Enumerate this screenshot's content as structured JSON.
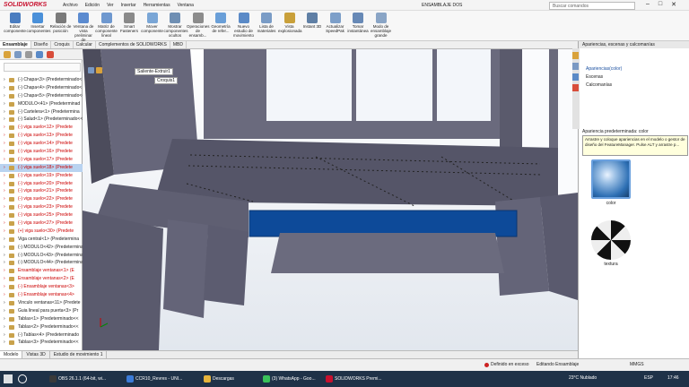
{
  "window": {
    "title": "ENSAMBLAJE DOS",
    "brand": "SOLIDWORKS",
    "search_placeholder": "Buscar comandos",
    "minimize": "–",
    "maximize": "□",
    "close": "✕"
  },
  "menu": [
    "Archivo",
    "Edición",
    "Ver",
    "Insertar",
    "Herramientas",
    "Ventana"
  ],
  "ribbon": [
    {
      "label": "Editar componente",
      "color": "#4a7dc0"
    },
    {
      "label": "Insertar componentes",
      "color": "#4a90d9"
    },
    {
      "label": "Relación de posición",
      "color": "#7a7a7a"
    },
    {
      "label": "Ventana de vista preliminar de componente",
      "color": "#5b8bd0"
    },
    {
      "label": "Matriz de componente lineal",
      "color": "#6e98cf"
    },
    {
      "label": "Smart Fasteners",
      "color": "#8a8a8a"
    },
    {
      "label": "Mover componente",
      "color": "#7aa6d6"
    },
    {
      "label": "Mostrar componentes ocultos",
      "color": "#6f8fb3"
    },
    {
      "label": "Operaciones de ensamb...",
      "color": "#8c8c8c"
    },
    {
      "label": "Geometría de refer...",
      "color": "#6a9fd8"
    },
    {
      "label": "Nuevo estudio de movimiento",
      "color": "#5a8ac7"
    },
    {
      "label": "Lista de materiales",
      "color": "#7a9cc6"
    },
    {
      "label": "Vista explosionada",
      "color": "#c9a03a"
    },
    {
      "label": "Instant 3D",
      "color": "#5f7fa5"
    },
    {
      "label": "Actualizar SpeedPak",
      "color": "#7d9fc9"
    },
    {
      "label": "Tomar instantánea",
      "color": "#6789b6"
    },
    {
      "label": "Modo de ensamblaje grande",
      "color": "#8aa5c6"
    }
  ],
  "command_tabs": [
    "Ensamblaje",
    "Diseño",
    "Croquis",
    "Calcular",
    "Complementos de SOLIDWORKS",
    "MBD"
  ],
  "breadcrumb": {
    "feature": "Saliente-Extruir1",
    "sketch": "Croquis1"
  },
  "tree": [
    {
      "label": "(-) Chapa<3> (Predeterminado<",
      "red": false
    },
    {
      "label": "(-) Chapa<4> (Predeterminado<",
      "red": false
    },
    {
      "label": "(-) Chapa<5> (Predeterminado<<",
      "red": false
    },
    {
      "label": "MODULO<41> (Predeterminad",
      "red": false
    },
    {
      "label": "(-) Cartelera<1> (Predetermina",
      "red": false
    },
    {
      "label": "(-) Salud<1> (Predeterminado<<",
      "red": false
    },
    {
      "label": "(-) viga suelo<12> (Predete",
      "red": true
    },
    {
      "label": "(-) viga suelo<13> (Predete",
      "red": true
    },
    {
      "label": "(-) viga suelo<14> (Predete",
      "red": true
    },
    {
      "label": "(-) viga suelo<16> (Predete",
      "red": true
    },
    {
      "label": "(-) viga suelo<17> (Predete",
      "red": true
    },
    {
      "label": "(-) viga suelo<18> (Predete",
      "red": true,
      "selected": true
    },
    {
      "label": "(-) viga suelo<19> (Predete",
      "red": true
    },
    {
      "label": "(-) viga suelo<20> (Predete",
      "red": true
    },
    {
      "label": "(-) viga suelo<21> (Predete",
      "red": true
    },
    {
      "label": "(-) viga suelo<22> (Predete",
      "red": true
    },
    {
      "label": "(-) viga suelo<23> (Predete",
      "red": true
    },
    {
      "label": "(-) viga suelo<25> (Predete",
      "red": true
    },
    {
      "label": "(-) viga suelo<27> (Predete",
      "red": true
    },
    {
      "label": "(+) viga suelo<30> (Predete",
      "red": true
    },
    {
      "label": "Viga central<1> (Predetermina",
      "red": false
    },
    {
      "label": "(-) MODULO<42> (Predetermina",
      "red": false
    },
    {
      "label": "(-) MODULO<43> (Predetermina",
      "red": false
    },
    {
      "label": "(-) MODULO<44> (Predetermina",
      "red": false
    },
    {
      "label": "Ensamblaje ventanas<1> (E",
      "red": true
    },
    {
      "label": "Ensamblaje ventanas<2> (E",
      "red": true
    },
    {
      "label": "(-) Ensamblaje ventanas<3>",
      "red": true
    },
    {
      "label": "(-) Ensamblaje ventanas<4>",
      "red": true
    },
    {
      "label": "Vinculo ventanas<11> (Predete",
      "red": false
    },
    {
      "label": "Guia lineal para puerta<3> (Pr",
      "red": false
    },
    {
      "label": "Tablas<1> (Predeterminado<<",
      "red": false
    },
    {
      "label": "Tablas<2> (Predeterminado<<",
      "red": false
    },
    {
      "label": "(-) Tablas<4> (Predeterminado",
      "red": false
    },
    {
      "label": "Tablas<3> (Predeterminado<<",
      "red": false
    }
  ],
  "view_tabs": [
    "Modelo",
    "Vistas 3D",
    "Estudio de movimiento 1"
  ],
  "right_panel": {
    "title": "Apariencias, escenas y calcomanías",
    "items": [
      "Apariencias(color)",
      "Escenas",
      "Calcomanías"
    ],
    "section": "Apariencia predeterminada: color",
    "tip": "Arrastre y coloque apariencias en el modelo o gestor de diseño del FeatureManager. Pulse ALT y arrastre p...",
    "swatch1": "color",
    "swatch2": "textura"
  },
  "status": {
    "warning": "Definido en exceso",
    "mode": "Editando Ensamblaje",
    "units": "MMGS",
    "warning_color": "#cc2222"
  },
  "taskbar": {
    "apps": [
      {
        "label": "OBS 26.1.1 (64-bit, wi...",
        "color": "#3a3a3a"
      },
      {
        "label": "CCR10_Revres - UNI...",
        "color": "#3b7bd8"
      },
      {
        "label": "Descargas",
        "color": "#e6b43c"
      },
      {
        "label": "(3) WhatsApp - Goo...",
        "color": "#3ac25a"
      },
      {
        "label": "SOLIDWORKS Premi...",
        "color": "#c8102e"
      }
    ],
    "weather": "23°C  Nublado",
    "lang": "ESP",
    "time": "17:46"
  },
  "colors": {
    "model": "#5c5c6c",
    "highlight": "#0d4a99",
    "accent": "#c8102e"
  }
}
